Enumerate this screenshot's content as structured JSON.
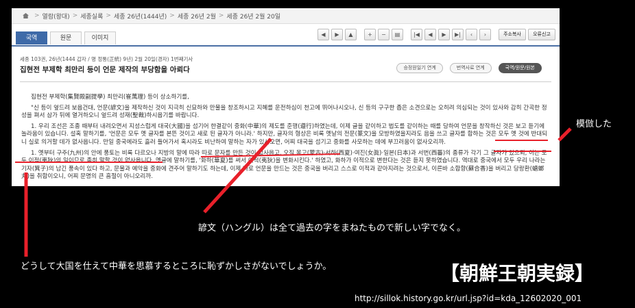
{
  "breadcrumb": [
    "열람(왕대)",
    "세종실록",
    "세종 26년(1444년)",
    "세종 26년 2월",
    "세종 26년 2월 20일"
  ],
  "tabs": [
    "국역",
    "원문",
    "이미지"
  ],
  "toolbar": {
    "print_label": "주소복사",
    "report_label": "오류신고"
  },
  "record": {
    "meta": "세종 103권, 26년(1444 갑자 / 명 정통(正統) 9년) 2월 20일(경자) 1번째기사",
    "title": "집현전 부제학 최만리 등이 언문 제작의 부당함을 아뢰다"
  },
  "pills": [
    "승정원일기 연계",
    "번역사료 연계",
    "국역/원문/원본"
  ],
  "body": {
    "p1": "집현전 부제학(集賢殿副提學) 최만리(崔萬理) 등이 상소하기를,",
    "p2": "\"신 등이 엎드려 보옵건대, 언문(諺文)을 제작하신 것이 지극히 신묘하와 만물을 창조하시고 지혜를 운전하심이 천고에 뛰어나시오나, 신 등의 구구한 좁은 소견으로는 오히려 의심되는 것이 있사와 감히 간곡한 정성을 펴서 삼가 뒤에 열거하오니 엎드려 성재(聖裁)하시옵기를 바랍니다.",
    "p3": "1. 우리 조선은 조종 때부터 내려오면서 지성스럽게 대국(大國)을 섬기어 한결같이 중화(中華)의 제도를 준행(遵行)하였는데, 이제 글을 같이하고 법도를 같이하는 때를 당하여 언문을 창작하신 것은 보고 듣기에 놀라움이 있습니다. 설혹 말하기를, '언문은 모두 옛 글자를 본뜬 것이고 새로 된 글자가 아니라.' 하지만, 글자의 형상은 비록 옛날의 전문(篆文)을 모방하였을지라도 음을 쓰고 글자를 합하는 것은 모두 옛 것에 반대되니 실로 의거할 데가 없사옵니다. 만일 중국에라도 흘러 들어가서 혹시라도 비난하여 말하는 자가 있사오면, 어찌 대국을 섬기고 중화를 사모하는 데에 부끄러움이 없사오리까.",
    "p4": "1. 옛부터 구주(九州)의 안에 풍토는 비록 다르오나 지방의 말에 따라 따로 문자를 만든 것이 없사옵고, 오직 몽고(蒙古)·서하(西夏)·여진(女眞)·일본(日本)과 서번(西蕃)의 종류가 각기 그 글자가 있으되, 이는 모두 이적(夷狄)의 일이므로 족히 말할 것이 없사옵니다. 옛글에 말하기를, '화하(華夏)를 써서 이적(夷狄)을 변화시킨다.' 하였고, 화하가 이적으로 변한다는 것은 듣지 못하였습니다. 역대로 중국에서 모두 우리 나라는 기자(箕子)의 남긴 풍속이 있다 하고, 문물과 예악을 중화에 견주어 말하기도 하는데, 이제 따로 언문을 만드는 것은 중국을 버리고 스스로 이적과 같아지려는 것으로서, 이른바 소합향(蘇合香)을 버리고 당랑환(螗螂丸)을 취함이오니, 어찌 문명의 큰 흠절이 아니오리까."
  },
  "captions": {
    "imitated": "模倣した",
    "hangul": "諺文（ハングル）は全て過去の字をまねたもので新しい字でなく。",
    "shame": "どうして大国を仕えて中華を思慕するところに恥ずかしさがないでしょうか。",
    "brand": "【朝鮮王朝実録】",
    "url": "http://sillok.history.go.kr/url.jsp?id=kda_12602020_001"
  },
  "colors": {
    "annotation": "#e8202a",
    "tab_active": "#3e6aa8"
  }
}
